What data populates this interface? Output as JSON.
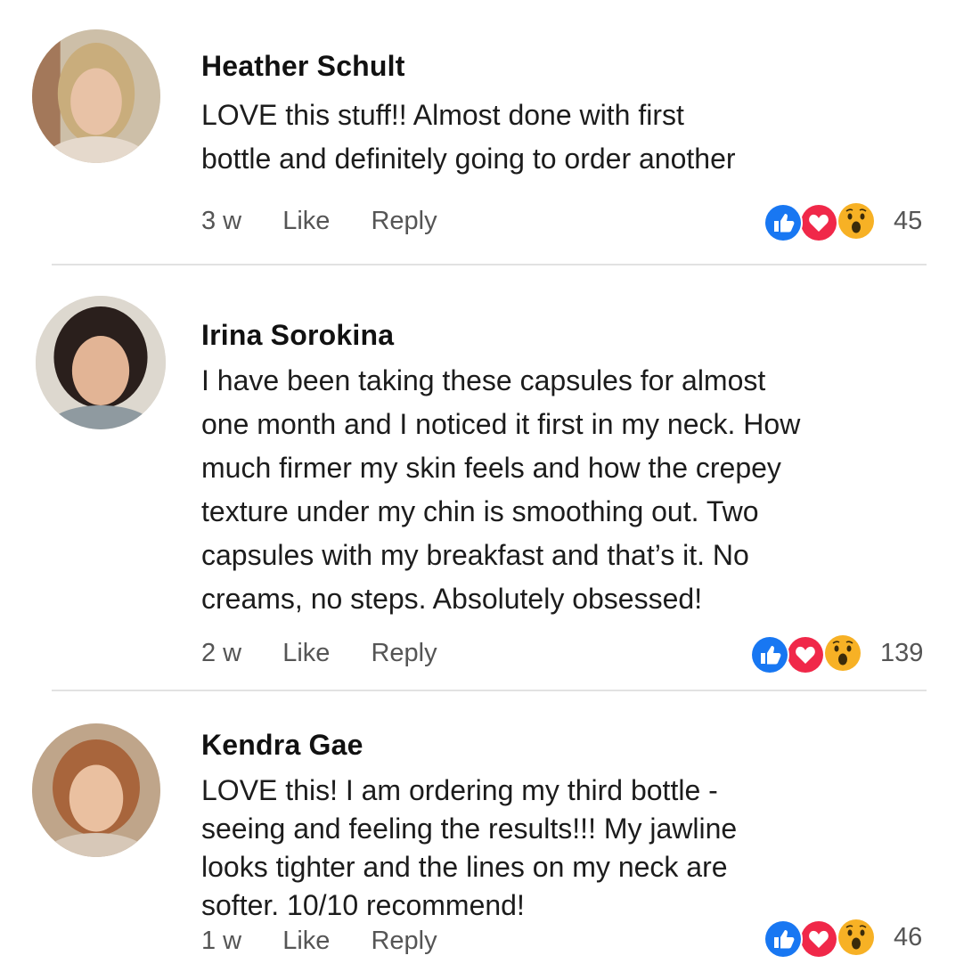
{
  "comments": [
    {
      "name": "Heather Schult",
      "lines": [
        "LOVE this stuff!! Almost done with first",
        "bottle and definitely going to order another"
      ],
      "time": "3 w",
      "like_label": "Like",
      "reply_label": "Reply",
      "reaction_count": "45",
      "reactions": [
        "like-icon",
        "love-icon",
        "wow-icon"
      ]
    },
    {
      "name": "Irina Sorokina",
      "lines": [
        "I have been taking these capsules for almost",
        "one month and I noticed it first in my neck. How",
        "much firmer my skin feels and how the crepey",
        "texture under my chin is smoothing out. Two",
        "capsules with my breakfast and that’s it. No",
        "creams, no steps. Absolutely obsessed!"
      ],
      "time": "2 w",
      "like_label": "Like",
      "reply_label": "Reply",
      "reaction_count": "139",
      "reactions": [
        "like-icon",
        "love-icon",
        "wow-icon"
      ]
    },
    {
      "name": "Kendra Gae",
      "lines": [
        "LOVE this! I am ordering my third bottle -",
        "seeing and feeling the results!!! My jawline",
        "looks tighter and the lines on my neck are",
        "softer. 10/10 recommend!"
      ],
      "time": "1 w",
      "like_label": "Like",
      "reply_label": "Reply",
      "reaction_count": "46",
      "reactions": [
        "like-icon",
        "love-icon",
        "wow-icon"
      ]
    }
  ],
  "colors": {
    "like_blue": "#1877f2",
    "love_red": "#f02849",
    "wow_yellow": "#f7b125",
    "divider": "#e2e2e2",
    "meta_gray": "#555555"
  }
}
